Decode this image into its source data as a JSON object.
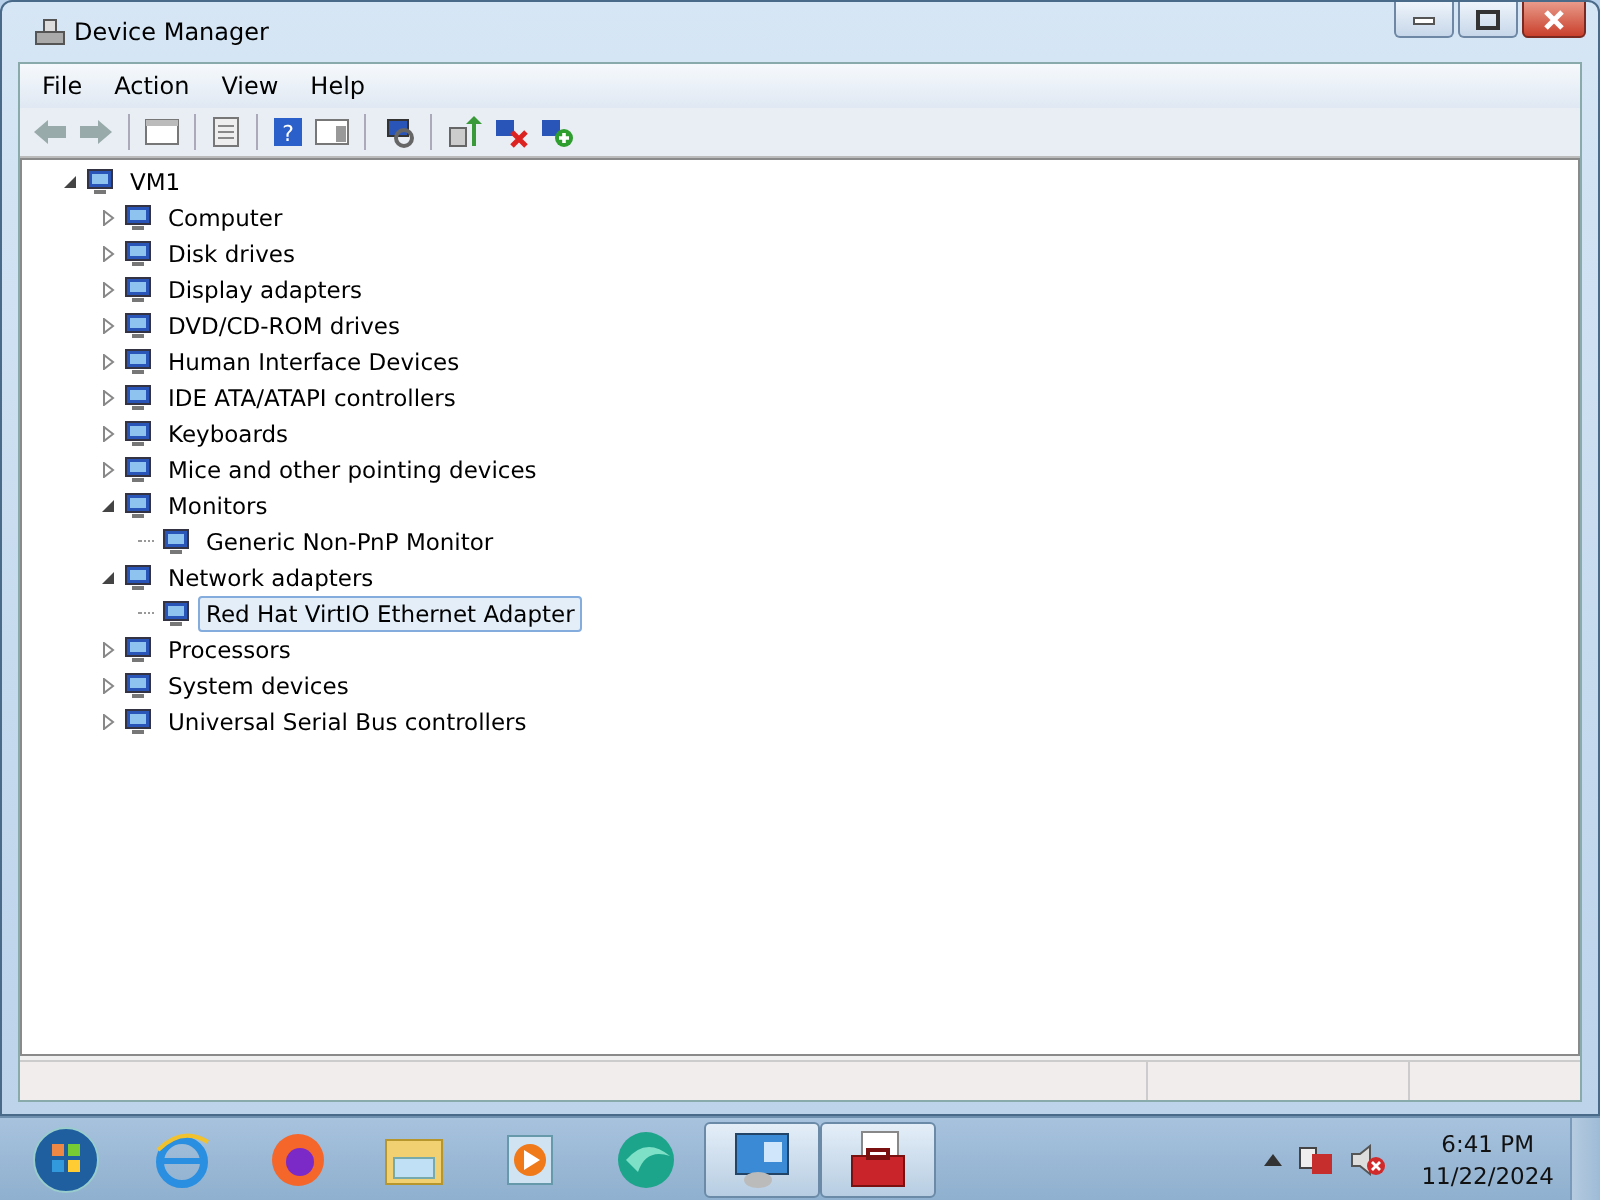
{
  "window": {
    "title": "Device Manager"
  },
  "menu": [
    "File",
    "Action",
    "View",
    "Help"
  ],
  "toolbar": {
    "help_glyph": "?"
  },
  "tree": [
    {
      "label": "VM1",
      "expanded": true,
      "selected": false,
      "children": [
        {
          "label": "Computer",
          "expanded": false,
          "selected": false
        },
        {
          "label": "Disk drives",
          "expanded": false,
          "selected": false
        },
        {
          "label": "Display adapters",
          "expanded": false,
          "selected": false
        },
        {
          "label": "DVD/CD-ROM drives",
          "expanded": false,
          "selected": false
        },
        {
          "label": "Human Interface Devices",
          "expanded": false,
          "selected": false
        },
        {
          "label": "IDE ATA/ATAPI controllers",
          "expanded": false,
          "selected": false
        },
        {
          "label": "Keyboards",
          "expanded": false,
          "selected": false
        },
        {
          "label": "Mice and other pointing devices",
          "expanded": false,
          "selected": false
        },
        {
          "label": "Monitors",
          "expanded": true,
          "selected": false,
          "children": [
            {
              "label": "Generic Non-PnP Monitor",
              "selected": false
            }
          ]
        },
        {
          "label": "Network adapters",
          "expanded": true,
          "selected": false,
          "children": [
            {
              "label": "Red Hat VirtIO Ethernet Adapter",
              "selected": true
            }
          ]
        },
        {
          "label": "Processors",
          "expanded": false,
          "selected": false
        },
        {
          "label": "System devices",
          "expanded": false,
          "selected": false
        },
        {
          "label": "Universal Serial Bus controllers",
          "expanded": false,
          "selected": false
        }
      ]
    }
  ],
  "taskbar": {
    "items": [
      {
        "kind": "start",
        "open": false
      },
      {
        "kind": "globe",
        "open": false
      },
      {
        "kind": "fox",
        "open": false
      },
      {
        "kind": "folder",
        "open": false
      },
      {
        "kind": "player",
        "open": false
      },
      {
        "kind": "orb",
        "open": false
      },
      {
        "kind": "panel",
        "open": true
      },
      {
        "kind": "toolbox",
        "open": true
      }
    ],
    "clock": {
      "time": "6:41 PM",
      "date": "11/22/2024"
    }
  }
}
